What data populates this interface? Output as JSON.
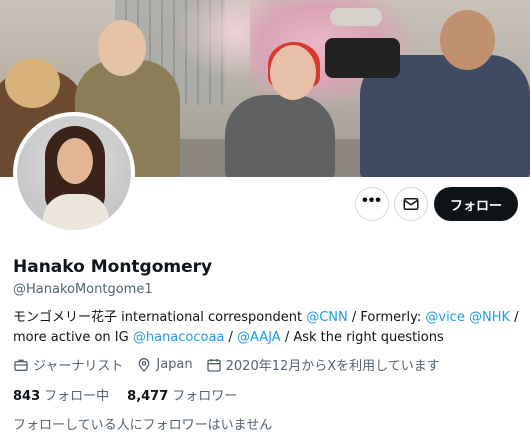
{
  "profile": {
    "name": "Hanako Montgomery",
    "handle": "@HanakoMontgome1"
  },
  "actions": {
    "more_label": "•••",
    "follow_label": "フォロー"
  },
  "bio": {
    "t1": "モンゴメリー花子 international correspondent ",
    "l1": "@CNN",
    "t2": " / Formerly: ",
    "l2": "@vice",
    "t3": " ",
    "l3": "@NHK",
    "t4": " / more active on IG ",
    "l4": "@hanacocoaa",
    "t5": " / ",
    "l5": "@AAJA",
    "t6": " / Ask the right questions"
  },
  "meta": {
    "profession": "ジャーナリスト",
    "location": "Japan",
    "joined": "2020年12月からXを利用しています"
  },
  "counts": {
    "following_num": "843",
    "following_label": "フォロー中",
    "followers_num": "8,477",
    "followers_label": "フォロワー"
  },
  "known_followers": "フォローしている人にフォロワーはいません",
  "colors": {
    "link": "#1d9bf0",
    "text": "#0f1419",
    "muted": "#536471",
    "follow_button": "#0f1419"
  },
  "icons": [
    "more-icon",
    "mail-icon",
    "briefcase-icon",
    "location-icon",
    "calendar-icon"
  ]
}
